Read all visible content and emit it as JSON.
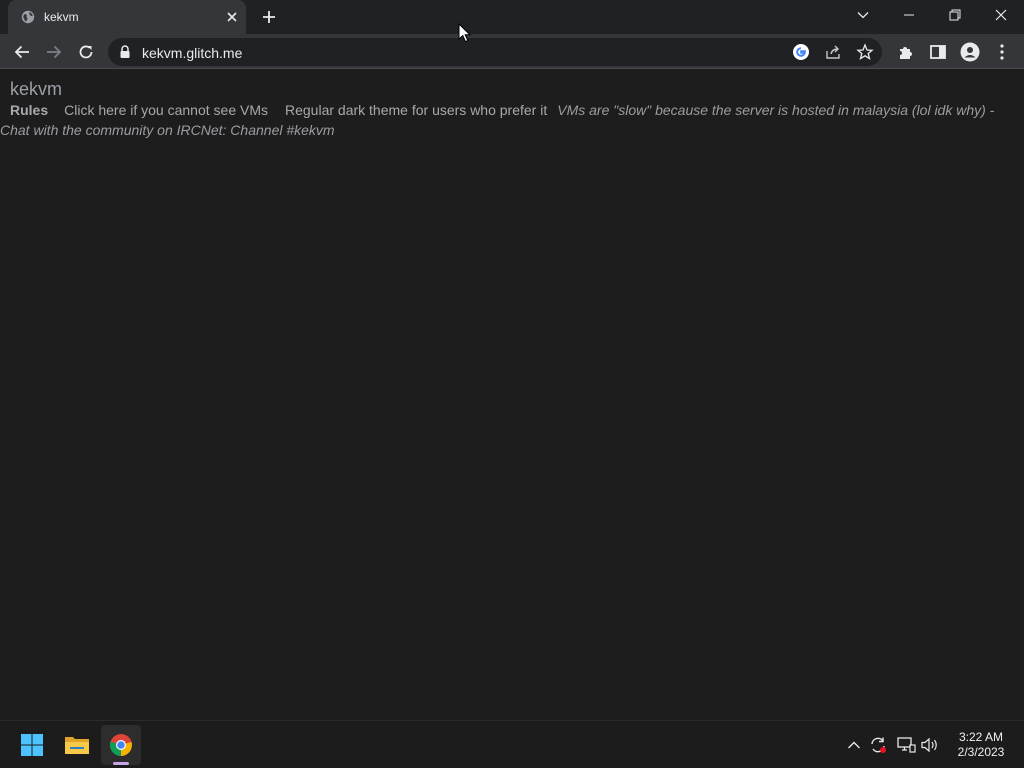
{
  "browser": {
    "tab": {
      "title": "kekvm"
    },
    "address": {
      "url": "kekvm.glitch.me"
    }
  },
  "page": {
    "site_title": "kekvm",
    "nav": {
      "rules": "Rules",
      "link_vms": "Click here if you cannot see VMs",
      "link_theme": "Regular dark theme for users who prefer it",
      "note": "VMs are \"slow\" because the server is hosted in malaysia (lol idk why) - Chat with the community on IRCNet: Channel #kekvm"
    }
  },
  "taskbar": {
    "time": "3:22 AM",
    "date": "2/3/2023",
    "apps": [
      "start-icon",
      "file-explorer-icon",
      "chrome-icon"
    ]
  },
  "colors": {
    "page_bg": "#1d1d1d",
    "tab_strip_bg": "#202124",
    "toolbar_bg": "#35363a",
    "text_muted": "#a7a9ad",
    "accent": "#c7a5e8"
  }
}
